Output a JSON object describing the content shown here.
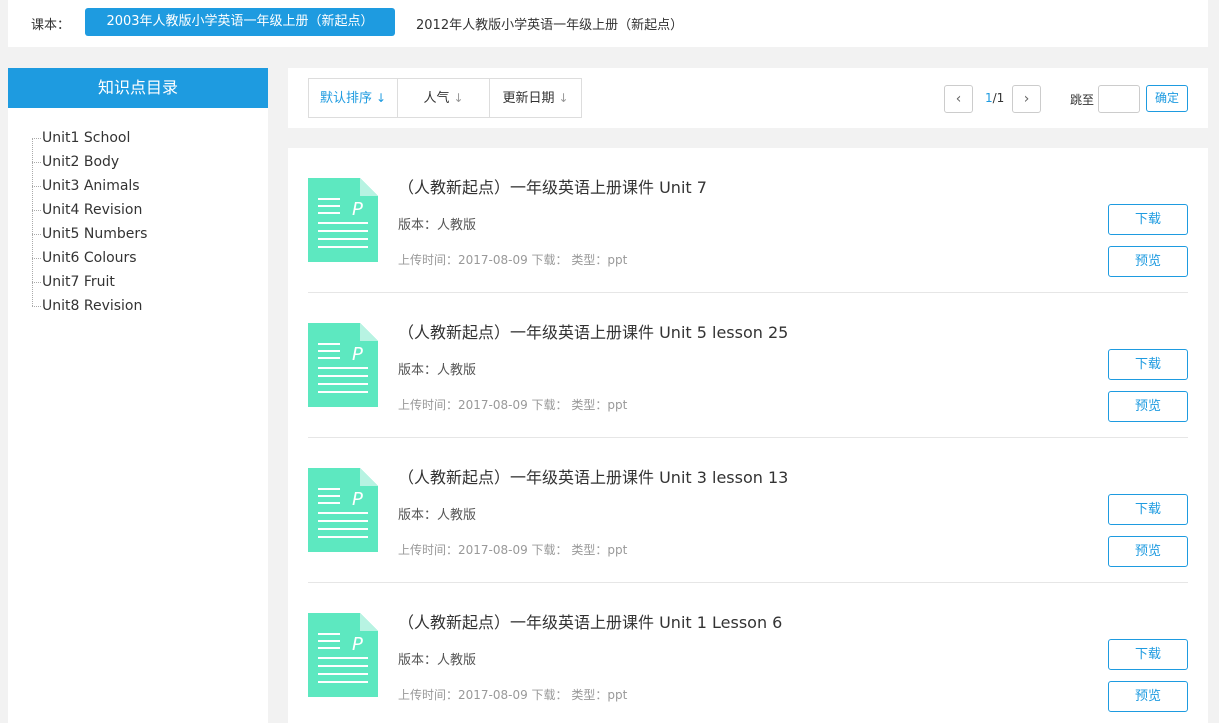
{
  "textbook_bar": {
    "label": "课本：",
    "options": [
      "2003年人教版小学英语一年级上册（新起点）",
      "2012年人教版小学英语一年级上册（新起点）"
    ]
  },
  "sidebar": {
    "title": "知识点目录",
    "items": [
      "Unit1 School",
      "Unit2 Body",
      "Unit3 Animals",
      "Unit4 Revision",
      "Unit5 Numbers",
      "Unit6 Colours",
      "Unit7 Fruit",
      "Unit8 Revision"
    ]
  },
  "sortbar": {
    "sort_default": "默认排序",
    "sort_popular": "人气",
    "sort_date": "更新日期",
    "arrow": "↓",
    "prev": "‹",
    "next": "›",
    "page_current": "1",
    "page_total": "/1",
    "jump_label": "跳至",
    "jump_value": "",
    "confirm": "确定"
  },
  "resources": [
    {
      "title": "（人教新起点）一年级英语上册课件 Unit 7",
      "version": "版本：人教版",
      "meta": "上传时间：2017-08-09 下载：  类型：ppt",
      "download": "下载",
      "preview": "预览"
    },
    {
      "title": "（人教新起点）一年级英语上册课件 Unit 5 lesson 25",
      "version": "版本：人教版",
      "meta": "上传时间：2017-08-09 下载：  类型：ppt",
      "download": "下载",
      "preview": "预览"
    },
    {
      "title": "（人教新起点）一年级英语上册课件 Unit 3 lesson 13",
      "version": "版本：人教版",
      "meta": "上传时间：2017-08-09 下载：  类型：ppt",
      "download": "下载",
      "preview": "预览"
    },
    {
      "title": "（人教新起点）一年级英语上册课件 Unit 1 Lesson 6",
      "version": "版本：人教版",
      "meta": "上传时间：2017-08-09 下载：  类型：ppt",
      "download": "下载",
      "preview": "预览"
    }
  ],
  "file_icon_letter": "P",
  "colors": {
    "accent": "#1e9be0",
    "file_icon": "#5de8c0",
    "file_icon_fold": "#b7f3e2"
  }
}
